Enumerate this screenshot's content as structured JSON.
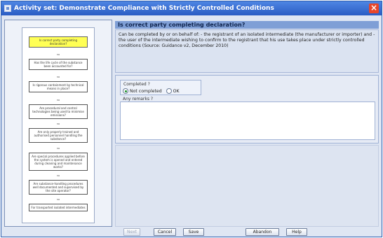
{
  "window": {
    "title": "Activity set: Demonstrate Compliance with Strictly Controlled Conditions"
  },
  "flowchart": {
    "nodes": [
      {
        "label": "Is correct party completing declaration?",
        "active": true
      },
      {
        "label": "Has the life cycle of the substance been accounted for?",
        "active": false
      },
      {
        "label": "Is rigorous containment by technical means in place?",
        "active": false
      },
      {
        "label": "Are procedural and control technologies being used to minimise emissions?",
        "active": false
      },
      {
        "label": "Are only properly trained and authorised personnel handling the substance?",
        "active": false
      },
      {
        "label": "Are special procedures applied before the system is opened and entered during cleaning and maintenance works?",
        "active": false
      },
      {
        "label": "Are substance-handling procedures well documented and supervised by the site operator?",
        "active": false
      },
      {
        "label": "For transported isolated intermediates",
        "active": false
      }
    ],
    "connector_label": "no"
  },
  "detail": {
    "heading": "Is correct party completing declaration?",
    "description": "Can be completed by or on behalf of: - the registrant of an isolated intermediate (the manufacturer or importer) and - the user of the intermediate wishing to confirm to the registrant that his use takes place under strictly controlled conditions (Source: Guidance v2, December 2010)"
  },
  "form": {
    "completed_label": "Completed ?",
    "options": [
      {
        "label": "Not completed",
        "checked": true
      },
      {
        "label": "OK",
        "checked": false
      }
    ],
    "remarks_label": "Any remarks ?",
    "remarks_value": ""
  },
  "buttons": {
    "next": "Next",
    "cancel": "Cancel",
    "save": "Save",
    "abandon": "Abandon",
    "help": "Help"
  }
}
